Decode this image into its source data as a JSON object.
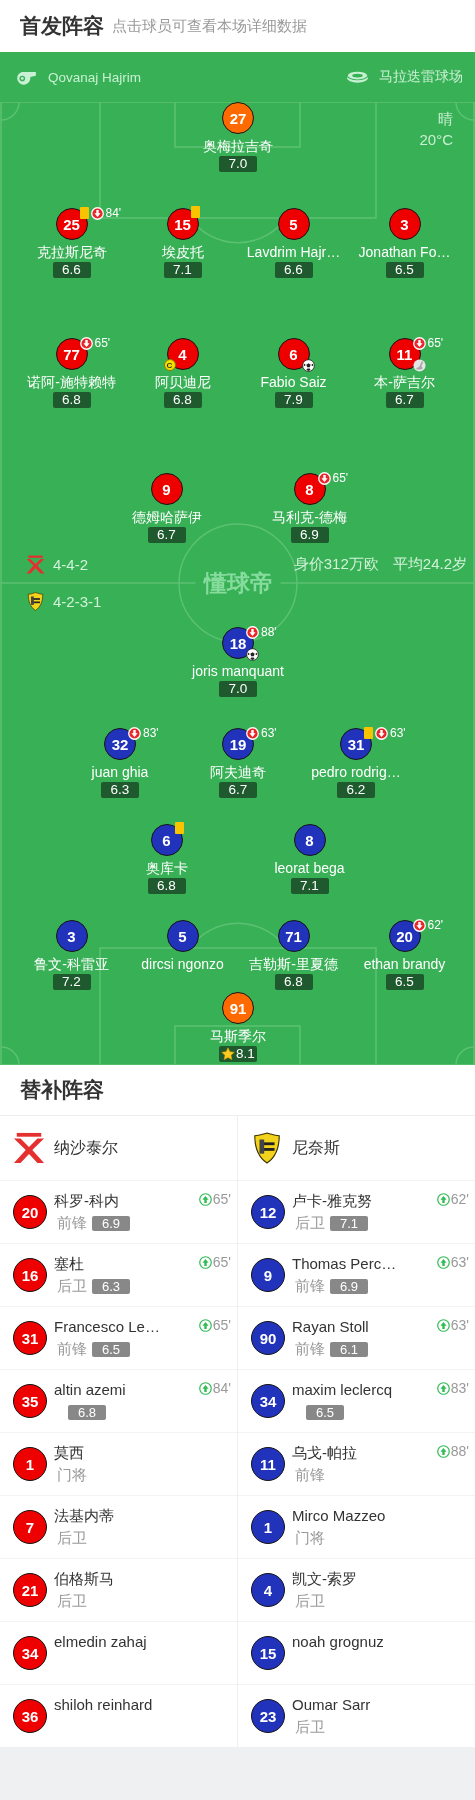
{
  "header": {
    "title": "首发阵容",
    "subtitle": "点击球员可查看本场详细数据"
  },
  "pitch": {
    "referee": "Qovanaj Hajrim",
    "stadium": "马拉迭雷球场",
    "weather": "晴",
    "temperature": "20°C",
    "watermark": "懂球帝",
    "home": {
      "color": "#ee0000",
      "formation": "4-4-2",
      "market_value": "身价312万欧",
      "average_age": "平均24.2岁",
      "lines": [
        [
          {
            "number": "27",
            "name": "奥梅拉吉奇",
            "rating": "7.0",
            "kind": "goalkeeper"
          }
        ],
        [
          {
            "number": "25",
            "name": "克拉斯尼奇",
            "rating": "6.6",
            "kind": "outfield",
            "events": [
              {
                "kind": "yellow_card"
              },
              {
                "kind": "sub_out",
                "minute": "84'"
              }
            ]
          },
          {
            "number": "15",
            "name": "埃皮托",
            "rating": "7.1",
            "kind": "outfield",
            "events": [
              {
                "kind": "yellow_card"
              }
            ]
          },
          {
            "number": "5",
            "name": "Lavdrim Hajr…",
            "rating": "6.6",
            "kind": "outfield"
          },
          {
            "number": "3",
            "name": "Jonathan Fo…",
            "rating": "6.5",
            "kind": "outfield"
          }
        ],
        [
          {
            "number": "77",
            "name": "诺阿-施特赖特",
            "rating": "6.8",
            "kind": "outfield",
            "events": [
              {
                "kind": "sub_out",
                "minute": "65'"
              }
            ]
          },
          {
            "number": "4",
            "name": "阿贝迪尼",
            "rating": "6.8",
            "kind": "outfield",
            "events": [
              {
                "kind": "captain",
                "label": "C"
              }
            ]
          },
          {
            "number": "6",
            "name": "Fabio Saiz",
            "rating": "7.9",
            "kind": "outfield",
            "events": [
              {
                "kind": "goal"
              }
            ]
          },
          {
            "number": "11",
            "name": "本-萨吉尔",
            "rating": "6.7",
            "kind": "outfield",
            "events": [
              {
                "kind": "sub_out",
                "minute": "65'"
              },
              {
                "kind": "assist"
              }
            ]
          }
        ],
        [
          {
            "number": "9",
            "name": "德姆哈萨伊",
            "rating": "6.7",
            "kind": "outfield"
          },
          {
            "number": "8",
            "name": "马利克-德梅",
            "rating": "6.9",
            "kind": "outfield",
            "events": [
              {
                "kind": "sub_out",
                "minute": "65'"
              }
            ]
          }
        ]
      ]
    },
    "away": {
      "color": "#2233bb",
      "formation": "4-2-3-1",
      "lines": [
        [
          {
            "number": "18",
            "name": "joris manquant",
            "rating": "7.0",
            "kind": "outfield",
            "events": [
              {
                "kind": "sub_out",
                "minute": "88'"
              },
              {
                "kind": "goal"
              }
            ]
          }
        ],
        [
          {
            "number": "32",
            "name": "juan ghia",
            "rating": "6.3",
            "kind": "outfield",
            "events": [
              {
                "kind": "sub_out",
                "minute": "83'"
              }
            ]
          },
          {
            "number": "19",
            "name": "阿夫迪奇",
            "rating": "6.7",
            "kind": "outfield",
            "events": [
              {
                "kind": "sub_out",
                "minute": "63'"
              }
            ]
          },
          {
            "number": "31",
            "name": "pedro rodrig…",
            "rating": "6.2",
            "kind": "outfield",
            "events": [
              {
                "kind": "yellow_card"
              },
              {
                "kind": "sub_out",
                "minute": "63'"
              }
            ]
          }
        ],
        [
          {
            "number": "6",
            "name": "奥库卡",
            "rating": "6.8",
            "kind": "outfield",
            "events": [
              {
                "kind": "yellow_card"
              }
            ]
          },
          {
            "number": "8",
            "name": "leorat bega",
            "rating": "7.1",
            "kind": "outfield"
          }
        ],
        [
          {
            "number": "3",
            "name": "鲁文-科雷亚",
            "rating": "7.2",
            "kind": "outfield"
          },
          {
            "number": "5",
            "name": "dircsi ngonzo",
            "kind": "outfield"
          },
          {
            "number": "71",
            "name": "吉勒斯-里夏德",
            "rating": "6.8",
            "kind": "outfield"
          },
          {
            "number": "20",
            "name": "ethan brandy",
            "rating": "6.5",
            "kind": "outfield",
            "events": [
              {
                "kind": "sub_out",
                "minute": "62'"
              }
            ]
          }
        ],
        [
          {
            "number": "91",
            "name": "马斯季尔",
            "rating": "8.1",
            "kind": "goalkeeper",
            "mvp": true
          }
        ]
      ]
    }
  },
  "subs": {
    "title": "替补阵容",
    "teams": [
      {
        "name": "纳沙泰尔",
        "color": "#ee0000",
        "players": [
          {
            "number": "20",
            "name": "科罗-科内",
            "position": "前锋",
            "rating": "6.9",
            "sub_in": "65'"
          },
          {
            "number": "16",
            "name": "塞杜",
            "position": "后卫",
            "rating": "6.3",
            "sub_in": "65'"
          },
          {
            "number": "31",
            "name": "Francesco Le…",
            "position": "前锋",
            "rating": "6.5",
            "sub_in": "65'"
          },
          {
            "number": "35",
            "name": "altin azemi",
            "rating": "6.8",
            "sub_in": "84'"
          },
          {
            "number": "1",
            "name": "莫西",
            "position": "门将"
          },
          {
            "number": "7",
            "name": "法基内蒂",
            "position": "后卫"
          },
          {
            "number": "21",
            "name": "伯格斯马",
            "position": "后卫"
          },
          {
            "number": "34",
            "name": "elmedin zahaj"
          },
          {
            "number": "36",
            "name": "shiloh reinhard"
          }
        ]
      },
      {
        "name": "尼奈斯",
        "color": "#2233bb",
        "players": [
          {
            "number": "12",
            "name": "卢卡-雅克努",
            "position": "后卫",
            "rating": "7.1",
            "sub_in": "62'"
          },
          {
            "number": "9",
            "name": "Thomas Perc…",
            "position": "前锋",
            "rating": "6.9",
            "sub_in": "63'"
          },
          {
            "number": "90",
            "name": "Rayan Stoll",
            "position": "前锋",
            "rating": "6.1",
            "sub_in": "63'"
          },
          {
            "number": "34",
            "name": "maxim leclercq",
            "rating": "6.5",
            "sub_in": "83'"
          },
          {
            "number": "11",
            "name": "乌戈-帕拉",
            "position": "前锋",
            "sub_in": "88'"
          },
          {
            "number": "1",
            "name": "Mirco Mazzeo",
            "position": "门将"
          },
          {
            "number": "4",
            "name": "凯文-索罗",
            "position": "后卫"
          },
          {
            "number": "15",
            "name": "noah grognuz"
          },
          {
            "number": "23",
            "name": "Oumar Sarr",
            "position": "后卫"
          }
        ]
      }
    ]
  }
}
